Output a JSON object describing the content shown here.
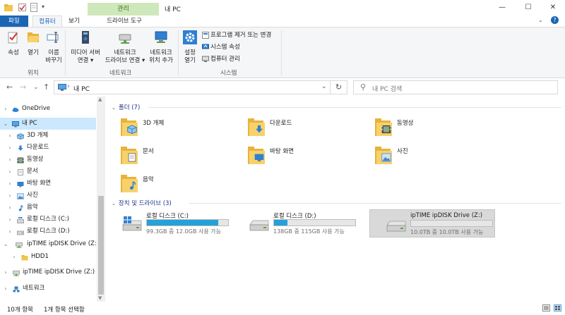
{
  "window": {
    "title": "내 PC",
    "context_tab": "관리",
    "minimize": "—",
    "maximize": "☐",
    "close": "✕"
  },
  "tabs": [
    "파일",
    "컴퓨터",
    "보기",
    "드라이브 도구"
  ],
  "ribbon": {
    "buttons": [
      {
        "line1": "속성",
        "line2": ""
      },
      {
        "line1": "열기",
        "line2": ""
      },
      {
        "line1": "이름",
        "line2": "바꾸기"
      },
      {
        "line1": "미디어 서버",
        "line2": "연결 ▾"
      },
      {
        "line1": "네트워크",
        "line2": "드라이브 연결 ▾"
      },
      {
        "line1": "네트워크",
        "line2": "위치 추가"
      },
      {
        "line1": "설정",
        "line2": "열기"
      }
    ],
    "system_items": [
      "프로그램 제거 또는 변경",
      "시스템 속성",
      "컴퓨터 관리"
    ],
    "groups": [
      "위치",
      "네트워크",
      "시스템"
    ]
  },
  "address": {
    "path_sep": "›",
    "path": "내 PC",
    "search_placeholder": "내 PC 검색",
    "back": "←",
    "forward": "→",
    "up": "↑",
    "dropdown": "⌄",
    "refresh": "↻",
    "search_icon": "⚲"
  },
  "nav": {
    "items": [
      {
        "label": "OneDrive",
        "chev": "›",
        "icon": "cloud-icon"
      },
      {
        "label": "내 PC",
        "chev": "⌄",
        "icon": "pc-icon"
      },
      {
        "label": "3D 개체",
        "chev": "›",
        "icon": "cube-icon"
      },
      {
        "label": "다운로드",
        "chev": "›",
        "icon": "download-icon"
      },
      {
        "label": "동영상",
        "chev": "›",
        "icon": "video-icon"
      },
      {
        "label": "문서",
        "chev": "›",
        "icon": "document-icon"
      },
      {
        "label": "바탕 화면",
        "chev": "›",
        "icon": "desktop-icon"
      },
      {
        "label": "사진",
        "chev": "›",
        "icon": "pictures-icon"
      },
      {
        "label": "음악",
        "chev": "›",
        "icon": "music-icon"
      },
      {
        "label": "로컬 디스크 (C:)",
        "chev": "›",
        "icon": "drive-windows-icon"
      },
      {
        "label": "로컬 디스크 (D:)",
        "chev": "›",
        "icon": "drive-icon"
      },
      {
        "label": "ipTIME ipDISK Drive (Z:)",
        "chev": "⌄",
        "icon": "network-drive-icon"
      },
      {
        "label": "HDD1",
        "chev": "›",
        "icon": "folder-icon"
      },
      {
        "label": "ipTIME ipDISK Drive (Z:)",
        "chev": "›",
        "icon": "network-drive-icon"
      },
      {
        "label": "네트워크",
        "chev": "›",
        "icon": "network-icon"
      }
    ]
  },
  "content": {
    "folders_header": "폴더 (7)",
    "folders": [
      "3D 개체",
      "다운로드",
      "동영상",
      "문서",
      "바탕 화면",
      "사진",
      "음악"
    ],
    "drives_header": "장치 및 드라이브 (3)",
    "drives": [
      {
        "name": "로컬 디스크 (C:)",
        "info": "99.3GB 중 12.0GB 사용 가능",
        "used_fraction": 0.879,
        "icon": "drive-windows-icon"
      },
      {
        "name": "로컬 디스크 (D:)",
        "info": "138GB 중 115GB 사용 가능",
        "used_fraction": 0.167,
        "icon": "drive-icon"
      },
      {
        "name": "ipTIME ipDISK Drive (Z:)",
        "info": "10.0TB 중 10.0TB 사용 가능",
        "used_fraction": 0.0,
        "icon": "network-drive-icon"
      }
    ]
  },
  "status": {
    "count": "10개 항목",
    "selected": "1개 항목 선택함"
  },
  "colors": {
    "accent": "#1a66b5",
    "drive_fill": "#26a0da",
    "context_tab_bg": "#cfe8bb",
    "selection": "#cce8ff"
  }
}
